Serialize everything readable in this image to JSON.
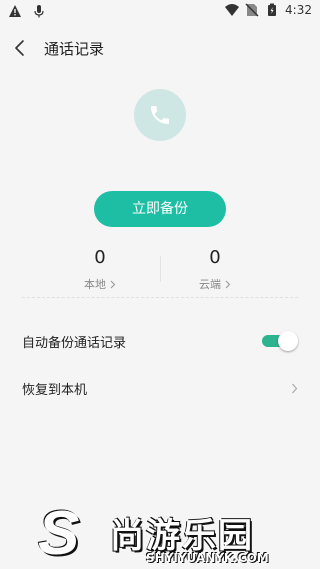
{
  "status_bar": {
    "time": "4:32",
    "icons": [
      "warning-icon",
      "mic-icon",
      "wifi-icon",
      "no-sim-icon",
      "battery-icon"
    ]
  },
  "header": {
    "title": "通话记录"
  },
  "backup_button": {
    "label": "立即备份"
  },
  "stats": {
    "local": {
      "count": "0",
      "label": "本地"
    },
    "cloud": {
      "count": "0",
      "label": "云端"
    }
  },
  "settings": {
    "auto_backup": {
      "label": "自动备份通话记录",
      "enabled": true
    },
    "restore": {
      "label": "恢复到本机"
    }
  },
  "watermark": {
    "brand_cn": "尚游乐园",
    "brand_en": "SHYIYUANYK.COM"
  },
  "colors": {
    "accent": "#1ebea5",
    "toggle": "#2db38f",
    "avatar_bg": "#cfe7e4"
  }
}
